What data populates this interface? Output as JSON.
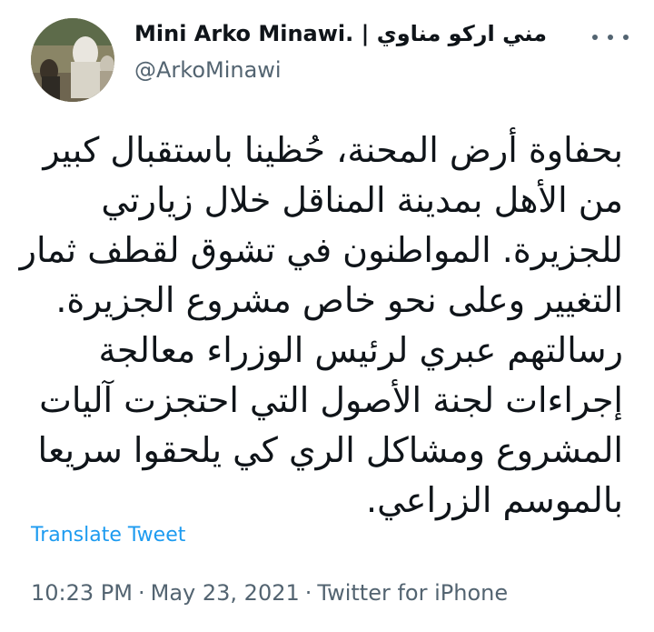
{
  "author": {
    "display_name": "Mini Arko Minawi. | مني اركو مناوي",
    "handle": "@ArkoMinawi"
  },
  "more_icon": "more-horizontal-icon",
  "tweet": {
    "lines": [
      "بحفاوة أرض المحنة، حُظينا باستقبال كبير",
      "من الأهل بمدينة المناقل خلال زيارتي",
      "للجزيرة. المواطنون في تشوق لقطف ثمار",
      "التغيير وعلى نحو خاص مشروع الجزيرة.",
      "رسالتهم عبري لرئيس الوزراء معالجة",
      "إجراءات لجنة الأصول التي احتجزت آليات",
      "المشروع ومشاكل الري كي يلحقوا سريعا",
      "بالموسم الزراعي."
    ]
  },
  "translate_label": "Translate Tweet",
  "meta": {
    "time": "10:23 PM",
    "separator": "·",
    "date": "May 23, 2021",
    "source": "Twitter for iPhone"
  },
  "colors": {
    "text": "#0f1419",
    "secondary": "#536471",
    "link": "#1d9bf0"
  }
}
